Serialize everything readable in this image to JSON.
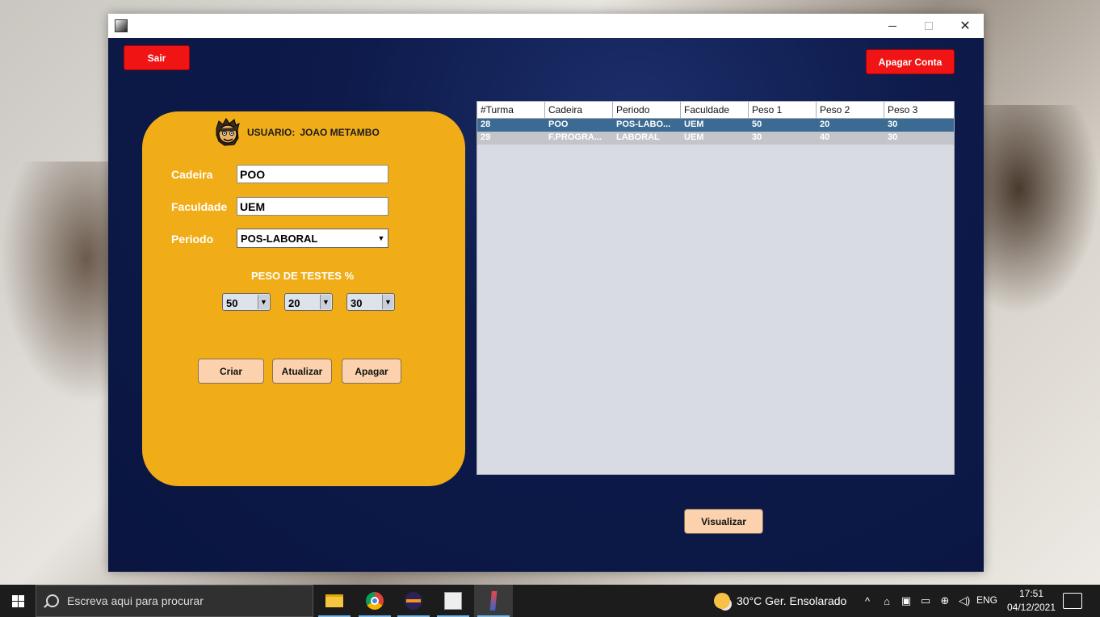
{
  "window": {
    "minimize": "—",
    "maximize": "☐",
    "close": "✕"
  },
  "header": {
    "sair": "Sair",
    "apagar_conta": "Apagar Conta"
  },
  "form": {
    "user_prefix": "USUARIO:",
    "user_name": "JOAO METAMBO",
    "cadeira_label": "Cadeira",
    "cadeira_value": "POO",
    "faculdade_label": "Faculdade",
    "faculdade_value": "UEM",
    "periodo_label": "Periodo",
    "periodo_value": "POS-LABORAL",
    "peso_title": "PESO DE TESTES %",
    "peso1": "50",
    "peso2": "20",
    "peso3": "30",
    "arrow": "▼",
    "criar": "Criar",
    "atualizar": "Atualizar",
    "apagar": "Apagar"
  },
  "table": {
    "columns": [
      "#Turma",
      "Cadeira",
      "Periodo",
      "Faculdade",
      "Peso 1",
      "Peso 2",
      "Peso 3"
    ],
    "rows": [
      [
        "28",
        "POO",
        "POS-LABO...",
        "UEM",
        "50",
        "20",
        "30"
      ],
      [
        "29",
        "F.PROGRA...",
        "LABORAL",
        "UEM",
        "30",
        "40",
        "30"
      ]
    ],
    "selected_row": 0
  },
  "visualizar": "Visualizar",
  "taskbar": {
    "search_placeholder": "Escreva aqui para procurar",
    "weather": "30°C  Ger. Ensolarado",
    "lang": "ENG",
    "time": "17:51",
    "date": "04/12/2021",
    "tray": [
      "^",
      "⌂",
      "▣",
      "▭",
      "⊕",
      "◁)"
    ]
  },
  "colors": {
    "content_bg": "#0e1b4d",
    "panel": "#f0ad17",
    "red_button": "#f01414",
    "peach_button": "#fbd2ad",
    "selected_row": "#3b6b93"
  }
}
